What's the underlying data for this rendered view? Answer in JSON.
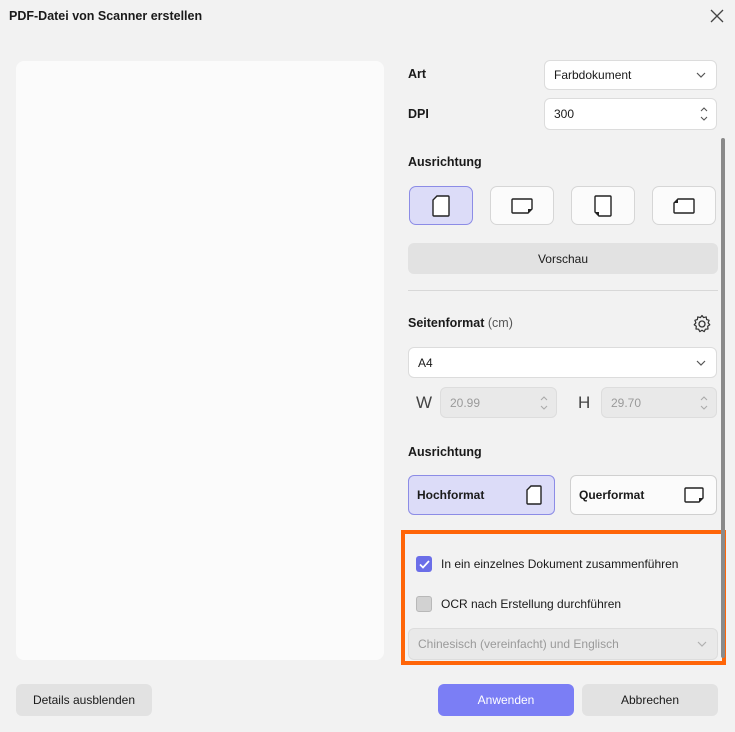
{
  "window": {
    "title": "PDF-Datei von Scanner erstellen"
  },
  "scan": {
    "type_label": "Art",
    "type_value": "Farbdokument",
    "dpi_label": "DPI",
    "dpi_value": "300",
    "orientation_label": "Ausrichtung",
    "orientation_selected": "portrait",
    "preview_label": "Vorschau"
  },
  "page_format": {
    "label": "Seitenformat",
    "unit": "(cm)",
    "size_value": "A4",
    "width_label": "W",
    "width_value": "20.99",
    "height_label": "H",
    "height_value": "29.70",
    "orientation_label": "Ausrichtung",
    "portrait_label": "Hochformat",
    "landscape_label": "Querformat",
    "selected": "portrait"
  },
  "options": {
    "merge_label": "In ein einzelnes Dokument zusammenführen",
    "merge_checked": true,
    "ocr_label": "OCR nach Erstellung durchführen",
    "ocr_checked": false,
    "ocr_language": "Chinesisch (vereinfacht) und Englisch"
  },
  "footer": {
    "details_label": "Details ausblenden",
    "apply_label": "Anwenden",
    "cancel_label": "Abbrechen"
  },
  "colors": {
    "accent": "#7b7ef5",
    "highlight": "#ff6508",
    "selected_bg": "#dcdcf8"
  }
}
